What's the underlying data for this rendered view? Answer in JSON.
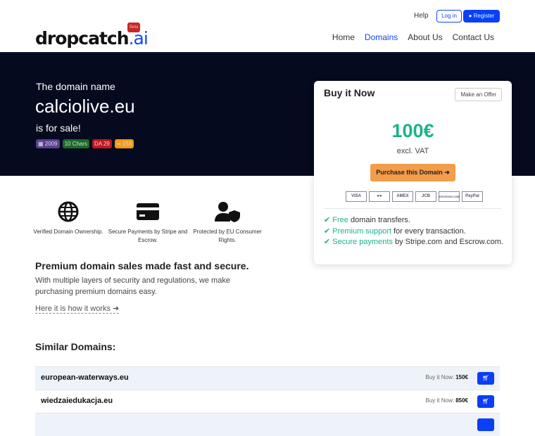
{
  "header": {
    "logo_main": "dropcatch",
    "logo_tld": ".ai",
    "beta": "Beta",
    "help": "Help",
    "login": "Log in",
    "register": "Register",
    "nav": [
      "Home",
      "Domains",
      "About Us",
      "Contact Us"
    ]
  },
  "hero": {
    "intro": "The domain name",
    "domain": "calciolive.eu",
    "outro": "is for sale!",
    "badges": [
      {
        "label": "2009",
        "color": "#5b3f8f"
      },
      {
        "label": "10 Chars",
        "color": "#1c6a2a"
      },
      {
        "label": "DA 29",
        "color": "#c0181f"
      },
      {
        "label": "158",
        "color": "#f39a18"
      }
    ]
  },
  "card": {
    "title": "Buy it Now",
    "offer": "Make an Offer",
    "price": "100€",
    "vat": "excl. VAT",
    "purchase": "Purchase this Domain",
    "payments": [
      "VISA",
      "●●",
      "AMEX",
      "JCB",
      "ESCROW.COM",
      "PayPal"
    ],
    "features": [
      {
        "hl": "Free",
        "rest": " domain transfers."
      },
      {
        "hl": "Premium support",
        "rest": " for every transaction."
      },
      {
        "hl": "Secure payments",
        "rest": " by Stripe.com and Escrow.com."
      }
    ]
  },
  "icons": [
    {
      "label": "Verified Domain Ownership."
    },
    {
      "label": "Secure Payments by Stripe and Escrow."
    },
    {
      "label": "Protected by EU Consumer Rights."
    }
  ],
  "premium": {
    "title": "Premium domain sales made fast and secure.",
    "desc": "With multiple layers of security and regulations, we make purchasing premium domains easy.",
    "link": "Here it is how it works"
  },
  "similar": {
    "title": "Similar Domains:",
    "buy_label": "Buy it Now:",
    "rows": [
      {
        "domain": "european-waterways.eu",
        "price": "150€"
      },
      {
        "domain": "wiedzaiedukacja.eu",
        "price": "850€"
      }
    ]
  }
}
